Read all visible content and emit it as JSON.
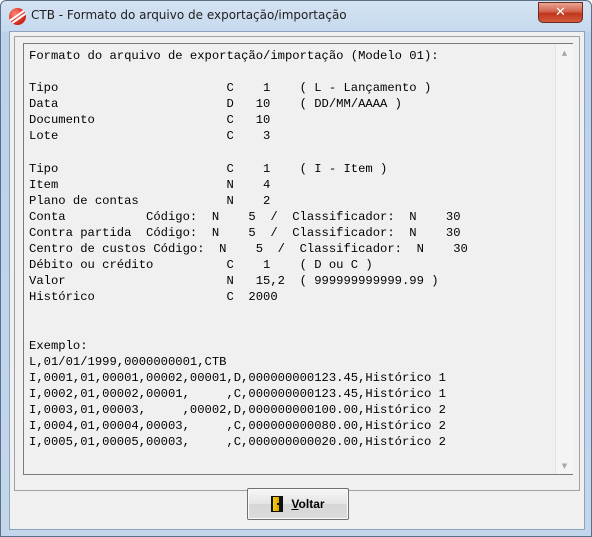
{
  "window": {
    "title": "CTB - Formato do arquivo de exportação/importação",
    "close_glyph": "✕"
  },
  "memo": {
    "lines": [
      "Formato do arquivo de exportação/importação (Modelo 01):",
      "",
      "Tipo                       C    1    ( L - Lançamento )",
      "Data                       D   10    ( DD/MM/AAAA )",
      "Documento                  C   10",
      "Lote                       C    3",
      "",
      "Tipo                       C    1    ( I - Item )",
      "Item                       N    4",
      "Plano de contas            N    2",
      "Conta           Código:  N    5  /  Classificador:  N    30",
      "Contra partida  Código:  N    5  /  Classificador:  N    30",
      "Centro de custos Código:  N    5  /  Classificador:  N    30",
      "Débito ou crédito          C    1    ( D ou C )",
      "Valor                      N   15,2  ( 999999999999.99 )",
      "Histórico                  C  2000",
      "",
      "",
      "Exemplo:",
      "L,01/01/1999,0000000001,CTB",
      "I,0001,01,00001,00002,00001,D,000000000123.45,Histórico 1",
      "I,0002,01,00002,00001,     ,C,000000000123.45,Histórico 1",
      "I,0003,01,00003,     ,00002,D,000000000100.00,Histórico 2",
      "I,0004,01,00004,00003,     ,C,000000000080.00,Histórico 2",
      "I,0005,01,00005,00003,     ,C,000000000020.00,Histórico 2"
    ]
  },
  "scrollbar": {
    "up_glyph": "▲",
    "down_glyph": "▼"
  },
  "buttons": {
    "voltar_access_key": "V",
    "voltar_rest": "oltar",
    "voltar_icon": "exit-door-icon"
  }
}
